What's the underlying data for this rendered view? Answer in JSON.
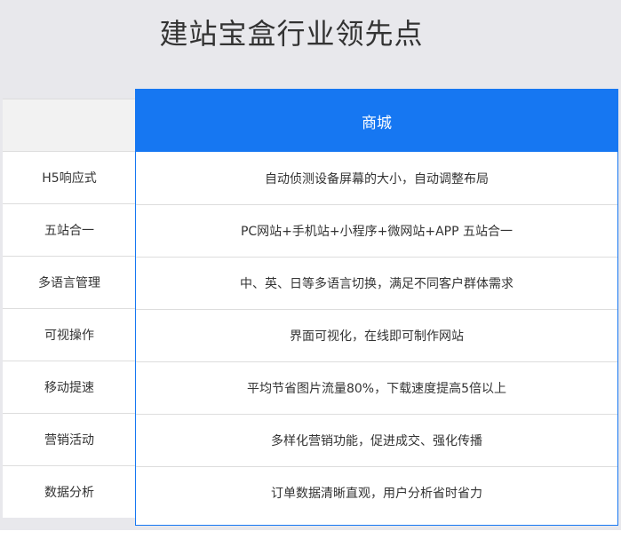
{
  "title": "建站宝盒行业领先点",
  "column_header": "商城",
  "rows": [
    {
      "feature": "H5响应式",
      "description": "自动侦测设备屏幕的大小，自动调整布局"
    },
    {
      "feature": "五站合一",
      "description": "PC网站+手机站+小程序+微网站+APP 五站合一"
    },
    {
      "feature": "多语言管理",
      "description": "中、英、日等多语言切换，满足不同客户群体需求"
    },
    {
      "feature": "可视操作",
      "description": "界面可视化，在线即可制作网站"
    },
    {
      "feature": "移动提速",
      "description": "平均节省图片流量80%，下载速度提高5倍以上"
    },
    {
      "feature": "营销活动",
      "description": "多样化营销功能，促进成交、强化传播"
    },
    {
      "feature": "数据分析",
      "description": "订单数据清晰直观，用户分析省时省力"
    }
  ],
  "colors": {
    "accent": "#1677f2",
    "background": "#e8e8ec",
    "header_cell": "#f2f2f2",
    "text": "#333333"
  }
}
